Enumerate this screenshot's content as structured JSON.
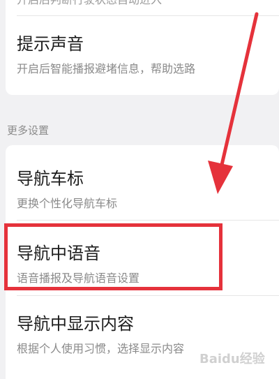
{
  "settings_top": {
    "partial_subtitle": "开启后判断行驶状态自动进入",
    "prompt_sound": {
      "title": "提示声音",
      "subtitle": "开启后智能播报避堵信息，帮助选路"
    }
  },
  "more_settings": {
    "section_label": "更多设置",
    "items": [
      {
        "title": "导航车标",
        "subtitle": "更换个性化导航车标"
      },
      {
        "title": "导航中语音",
        "subtitle": "语音播报及导航语音设置"
      },
      {
        "title": "导航中显示内容",
        "subtitle": "根据个人使用习惯，选择显示内容"
      }
    ]
  },
  "annotation": {
    "highlight_color": "#e5323b",
    "arrow_color": "#e5323b"
  },
  "watermark": {
    "text": "Baidu经验"
  }
}
